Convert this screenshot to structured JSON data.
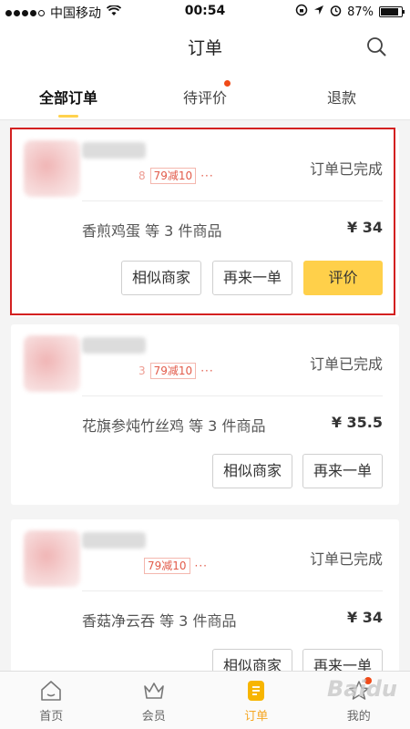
{
  "statusbar": {
    "carrier": "中国移动",
    "time": "00:54",
    "battery_pct": "87%",
    "signal_filled": 4,
    "battery_level": 0.87
  },
  "header": {
    "title": "订单",
    "search_icon": "search-icon"
  },
  "tabs": [
    {
      "label": "全部订单",
      "active": true,
      "badge": false
    },
    {
      "label": "待评价",
      "active": false,
      "badge": true
    },
    {
      "label": "退款",
      "active": false,
      "badge": false
    }
  ],
  "orders": [
    {
      "status": "订单已完成",
      "promo_fragment": "8",
      "promo": "79减10",
      "more": "···",
      "summary": "香煎鸡蛋   等 3 件商品",
      "price": "¥ 34",
      "buttons": [
        "相似商家",
        "再来一单",
        "评价"
      ]
    },
    {
      "status": "订单已完成",
      "promo_fragment": "3",
      "promo": "79减10",
      "more": "···",
      "summary": "花旗参炖竹丝鸡   等 3 件商品",
      "price": "¥ 35.5",
      "buttons": [
        "相似商家",
        "再来一单"
      ]
    },
    {
      "status": "订单已完成",
      "promo_fragment": "",
      "promo": "79减10",
      "more": "···",
      "summary": "香菇净云吞   等 3 件商品",
      "price": "¥ 34",
      "buttons": [
        "相似商家",
        "再来一单"
      ]
    }
  ],
  "bottomnav": [
    {
      "label": "首页",
      "icon": "home-icon",
      "active": false
    },
    {
      "label": "会员",
      "icon": "crown-icon",
      "active": false
    },
    {
      "label": "订单",
      "icon": "order-icon",
      "active": true
    },
    {
      "label": "我的",
      "icon": "profile-icon",
      "active": false
    }
  ],
  "watermark": "Baidu",
  "colors": {
    "accent": "#ffd04a",
    "badge": "#f04a18",
    "highlight": "#d32020",
    "promo": "#e25b4a"
  }
}
